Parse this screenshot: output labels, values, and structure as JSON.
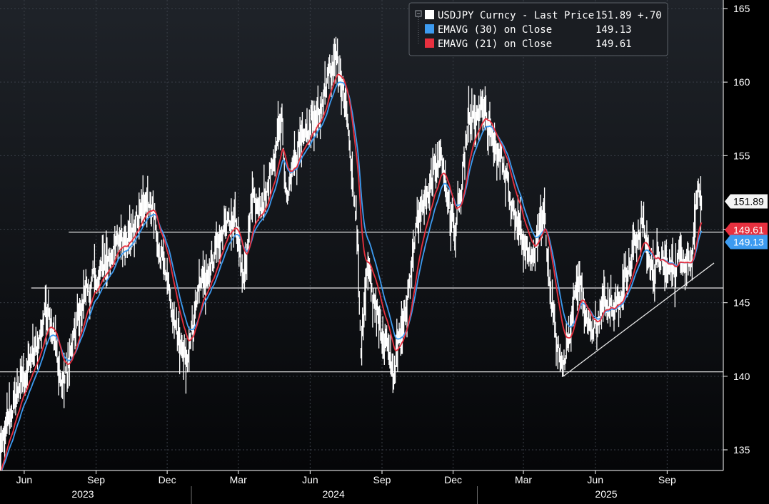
{
  "chart_data": {
    "type": "line",
    "ticker": "USDJPY Curncy",
    "colors": {
      "background_top": "#1f2329",
      "background_bottom": "#050608",
      "price": "#ffffff",
      "ema30": "#3d9bf0",
      "ema21": "#e8303f",
      "grid": "#3a3f47",
      "reference_lines": "#e6e6e6"
    },
    "legend": {
      "placement": "top-center",
      "entries": [
        {
          "label": "USDJPY Curncy - Last Price",
          "value": "151.89",
          "change": "+.70",
          "color": "#ffffff"
        },
        {
          "label": "EMAVG (30)  on Close",
          "value": "149.13",
          "change": "",
          "color": "#3d9bf0"
        },
        {
          "label": "EMAVG (21)  on Close",
          "value": "149.61",
          "change": "",
          "color": "#e8303f"
        }
      ]
    },
    "y_axis": {
      "range": [
        134.4,
        167.9
      ],
      "ticks": [
        135,
        140,
        145,
        150,
        155,
        160,
        165
      ],
      "tick_labels": [
        "135",
        "140",
        "145",
        "150",
        "155",
        "160",
        "165"
      ],
      "side": "right"
    },
    "x_axis": {
      "range": [
        "2023-05-01",
        "2025-10-31"
      ],
      "month_labels": [
        {
          "date": "2023-06-01",
          "label": "Jun"
        },
        {
          "date": "2023-09-01",
          "label": "Sep"
        },
        {
          "date": "2023-12-01",
          "label": "Dec"
        },
        {
          "date": "2024-03-01",
          "label": "Mar"
        },
        {
          "date": "2024-06-01",
          "label": "Jun"
        },
        {
          "date": "2024-09-01",
          "label": "Sep"
        },
        {
          "date": "2024-12-01",
          "label": "Dec"
        },
        {
          "date": "2025-03-01",
          "label": "Mar"
        },
        {
          "date": "2025-06-01",
          "label": "Jun"
        },
        {
          "date": "2025-09-01",
          "label": "Sep"
        }
      ],
      "year_labels": [
        {
          "center": "2023-08-15",
          "label": "2023"
        },
        {
          "center": "2024-07-01",
          "label": "2024"
        },
        {
          "center": "2025-06-15",
          "label": "2025"
        }
      ],
      "year_boundaries": [
        "2024-01-01",
        "2025-01-01"
      ]
    },
    "price_anchors": [
      [
        "2023-05-01",
        134.6
      ],
      [
        "2023-05-10",
        136.5
      ],
      [
        "2023-05-22",
        138.8
      ],
      [
        "2023-06-02",
        140.3
      ],
      [
        "2023-06-15",
        141.5
      ],
      [
        "2023-06-28",
        144.5
      ],
      [
        "2023-07-03",
        145.0
      ],
      [
        "2023-07-10",
        142.3
      ],
      [
        "2023-07-20",
        139.2
      ],
      [
        "2023-07-28",
        140.8
      ],
      [
        "2023-08-08",
        143.5
      ],
      [
        "2023-08-20",
        146.0
      ],
      [
        "2023-09-01",
        146.5
      ],
      [
        "2023-09-15",
        147.8
      ],
      [
        "2023-09-29",
        149.3
      ],
      [
        "2023-10-15",
        149.7
      ],
      [
        "2023-10-31",
        151.5
      ],
      [
        "2023-11-13",
        151.9
      ],
      [
        "2023-11-20",
        148.2
      ],
      [
        "2023-11-30",
        147.2
      ],
      [
        "2023-12-07",
        144.5
      ],
      [
        "2023-12-14",
        142.0
      ],
      [
        "2023-12-28",
        141.0
      ],
      [
        "2024-01-05",
        144.5
      ],
      [
        "2024-01-15",
        146.5
      ],
      [
        "2024-01-29",
        148.0
      ],
      [
        "2024-02-13",
        150.5
      ],
      [
        "2024-02-26",
        150.2
      ],
      [
        "2024-03-08",
        146.8
      ],
      [
        "2024-03-19",
        151.5
      ],
      [
        "2024-03-28",
        151.3
      ],
      [
        "2024-04-10",
        153.2
      ],
      [
        "2024-04-26",
        158.0
      ],
      [
        "2024-04-29",
        154.0
      ],
      [
        "2024-05-03",
        152.8
      ],
      [
        "2024-05-20",
        156.5
      ],
      [
        "2024-05-31",
        157.2
      ],
      [
        "2024-06-14",
        158.0
      ],
      [
        "2024-06-26",
        160.8
      ],
      [
        "2024-07-03",
        161.7
      ],
      [
        "2024-07-11",
        159.5
      ],
      [
        "2024-07-20",
        157.0
      ],
      [
        "2024-07-31",
        150.0
      ],
      [
        "2024-08-05",
        142.0
      ],
      [
        "2024-08-15",
        147.5
      ],
      [
        "2024-08-25",
        144.3
      ],
      [
        "2024-09-06",
        142.5
      ],
      [
        "2024-09-16",
        140.5
      ],
      [
        "2024-09-25",
        143.0
      ],
      [
        "2024-10-01",
        144.0
      ],
      [
        "2024-10-11",
        149.0
      ],
      [
        "2024-10-22",
        151.5
      ],
      [
        "2024-11-01",
        152.5
      ],
      [
        "2024-11-15",
        155.5
      ],
      [
        "2024-11-27",
        151.0
      ],
      [
        "2024-12-03",
        149.8
      ],
      [
        "2024-12-12",
        152.5
      ],
      [
        "2024-12-20",
        157.2
      ],
      [
        "2025-01-02",
        157.5
      ],
      [
        "2025-01-10",
        158.0
      ],
      [
        "2025-01-20",
        156.0
      ],
      [
        "2025-01-31",
        155.0
      ],
      [
        "2025-02-10",
        152.5
      ],
      [
        "2025-02-20",
        150.3
      ],
      [
        "2025-03-03",
        149.2
      ],
      [
        "2025-03-11",
        147.5
      ],
      [
        "2025-03-20",
        149.5
      ],
      [
        "2025-03-28",
        150.5
      ],
      [
        "2025-04-04",
        146.5
      ],
      [
        "2025-04-11",
        143.0
      ],
      [
        "2025-04-21",
        140.8
      ],
      [
        "2025-05-01",
        143.5
      ],
      [
        "2025-05-12",
        147.5
      ],
      [
        "2025-05-20",
        144.0
      ],
      [
        "2025-05-30",
        143.0
      ],
      [
        "2025-06-10",
        144.8
      ],
      [
        "2025-06-20",
        145.5
      ],
      [
        "2025-07-01",
        145.0
      ],
      [
        "2025-07-10",
        147.0
      ],
      [
        "2025-07-20",
        148.5
      ],
      [
        "2025-07-31",
        150.5
      ],
      [
        "2025-08-10",
        147.5
      ],
      [
        "2025-08-20",
        147.8
      ],
      [
        "2025-09-01",
        147.2
      ],
      [
        "2025-09-12",
        147.6
      ],
      [
        "2025-09-22",
        148.5
      ],
      [
        "2025-09-30",
        147.5
      ],
      [
        "2025-10-06",
        150.3
      ],
      [
        "2025-10-10",
        153.0
      ],
      [
        "2025-10-13",
        152.3
      ],
      [
        "2025-10-15",
        151.89
      ]
    ],
    "reference_lines": [
      {
        "y": 149.8,
        "x_start": "2023-07-28"
      },
      {
        "y": 146.0,
        "x_start": "2023-06-10"
      },
      {
        "y": 140.3,
        "x_start": "2023-05-01"
      }
    ],
    "trend_line": {
      "from": [
        "2025-04-21",
        140.0
      ],
      "to": [
        "2025-10-31",
        147.7
      ]
    },
    "value_tags": [
      {
        "label": "151.89",
        "value": 151.89,
        "background": "#f4f4f4",
        "text_color": "#000000"
      },
      {
        "label": "149.61",
        "value": 149.95,
        "background": "#e8303f",
        "text_color": "#ffffff"
      },
      {
        "label": "149.13",
        "value": 149.13,
        "background": "#3d9bf0",
        "text_color": "#ffffff"
      }
    ]
  }
}
